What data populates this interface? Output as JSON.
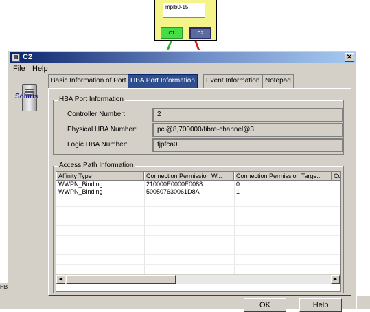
{
  "topology": {
    "node_label": "mplb0-15",
    "port_c1": "C1",
    "port_c2": "C2"
  },
  "left_strip_text": "HB",
  "right_strip_text": "",
  "window": {
    "title": "C2",
    "close_glyph": "✕"
  },
  "menu": {
    "file": "File",
    "help": "Help"
  },
  "os_label": "Solaris",
  "tabs": [
    {
      "label": "Basic Information of Port",
      "active": false
    },
    {
      "label": "HBA Port Information",
      "active": true
    },
    {
      "label": "Event Information",
      "active": false
    },
    {
      "label": "Notepad",
      "active": false
    }
  ],
  "hba_port_info": {
    "legend": "HBA Port Information",
    "controller_number_label": "Controller Number:",
    "controller_number": "2",
    "physical_hba_label": "Physical HBA Number:",
    "physical_hba": "pci@8,700000/fibre-channel@3",
    "logic_hba_label": "Logic HBA Number:",
    "logic_hba": "fjpfca0"
  },
  "access_path": {
    "legend": "Access Path Information",
    "columns": [
      "Affinity Type",
      "Connection Permission W...",
      "Connection Permission Targe...",
      "Co"
    ],
    "rows": [
      [
        "WWPN_Binding",
        "210000E0000E0088",
        "0",
        ""
      ],
      [
        "WWPN_Binding",
        "500507630061D8A",
        "1",
        ""
      ]
    ]
  },
  "buttons": {
    "ok": "OK",
    "help": "Help"
  },
  "colors": {
    "title_active": "#0a246a",
    "tab_active": "#2e4e8e",
    "node_yellow": "#f4f48a",
    "port_green": "#44dd44"
  }
}
